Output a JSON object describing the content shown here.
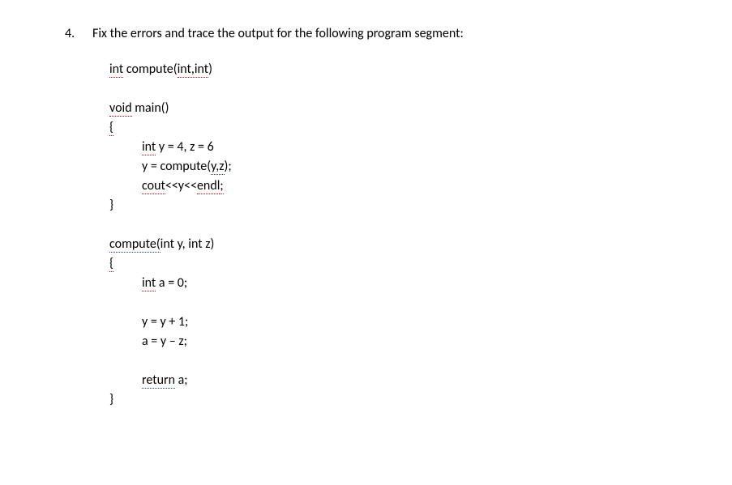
{
  "question": {
    "number": "4.",
    "prompt": "Fix the errors and trace the output for the following program segment:"
  },
  "code": {
    "l1_int": "int",
    "l1_rest": " compute(",
    "l1_intint": "int,int",
    "l1_close": ")",
    "l2_void": "void",
    "l2_main": " main()",
    "l3_brace": "{",
    "l4_int": "int",
    "l4_rest": " y = 4, z = 6",
    "l5_pre": "y = compute(",
    "l5_yz": "y,z",
    "l5_post": ");",
    "l6_cout": "cout",
    "l6_mid": "<<y<<",
    "l6_endl_e": "endl",
    "l6_semi": ";",
    "l7_brace": "}",
    "l8_compute": "compute(",
    "l8_rest": "int y, int z)",
    "l9_brace": "{",
    "l10_int": "int",
    "l10_rest": " a = 0;",
    "l11": "y = y + 1;",
    "l12": "a = y – z;",
    "l13_return": "return",
    "l13_rest": " a;",
    "l14_brace": "}"
  }
}
